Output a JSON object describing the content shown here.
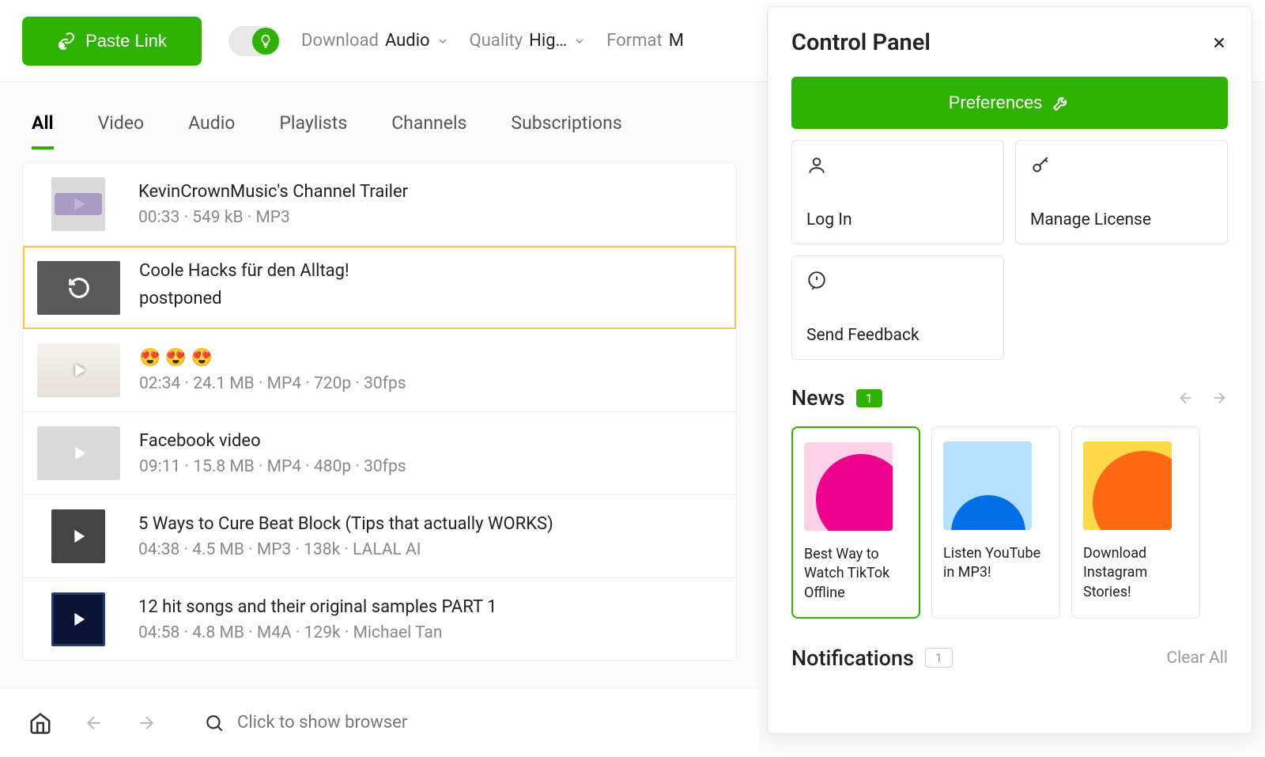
{
  "toolbar": {
    "paste_label": "Paste Link",
    "download_label": "Download",
    "download_value": "Audio",
    "quality_label": "Quality",
    "quality_value": "Hig…",
    "format_label": "Format",
    "format_value": "M"
  },
  "tabs": {
    "items": [
      {
        "label": "All",
        "active": true
      },
      {
        "label": "Video",
        "active": false
      },
      {
        "label": "Audio",
        "active": false
      },
      {
        "label": "Playlists",
        "active": false
      },
      {
        "label": "Channels",
        "active": false
      },
      {
        "label": "Subscriptions",
        "active": false
      }
    ]
  },
  "list": [
    {
      "title": "KevinCrownMusic's Channel Trailer",
      "meta": "00:33 · 549 kB · MP3",
      "thumb": "twitch",
      "square": true,
      "play": true
    },
    {
      "title": "Coole Hacks für den Alltag!",
      "subtitle": "postponed",
      "thumb": "retry",
      "highlight": true
    },
    {
      "title": "😍 😍 😍",
      "meta": "02:34 · 24.1 MB · MP4 · 720p · 30fps",
      "thumb": "wheel",
      "play": true
    },
    {
      "title": "Facebook video",
      "meta": "09:11 · 15.8 MB · MP4 · 480p · 30fps",
      "thumb": "grey",
      "play": true
    },
    {
      "title": "5 Ways to Cure Beat Block (Tips that actually WORKS)",
      "meta": "04:38 · 4.5 MB · MP3 · 138k · LALAL AI",
      "thumb": "beat",
      "square": true,
      "play": true
    },
    {
      "title": "12 hit songs and their original samples PART 1",
      "meta": "04:58 · 4.8 MB · M4A · 129k · Michael Tan",
      "thumb": "hits",
      "square": true,
      "play": true
    }
  ],
  "browser_placeholder": "Click to show browser",
  "panel": {
    "title": "Control Panel",
    "preferences": "Preferences",
    "login": "Log In",
    "license": "Manage License",
    "feedback": "Send Feedback",
    "news": "News",
    "news_badge": "1",
    "news_items": [
      {
        "text": "Best Way to Watch TikTok Offline",
        "active": true,
        "art": "art1"
      },
      {
        "text": "Listen YouTube in MP3!",
        "art": "art2"
      },
      {
        "text": "Download Instagram Stories!",
        "art": "art3"
      }
    ],
    "notifications": "Notifications",
    "notif_badge": "1",
    "clear": "Clear All"
  }
}
